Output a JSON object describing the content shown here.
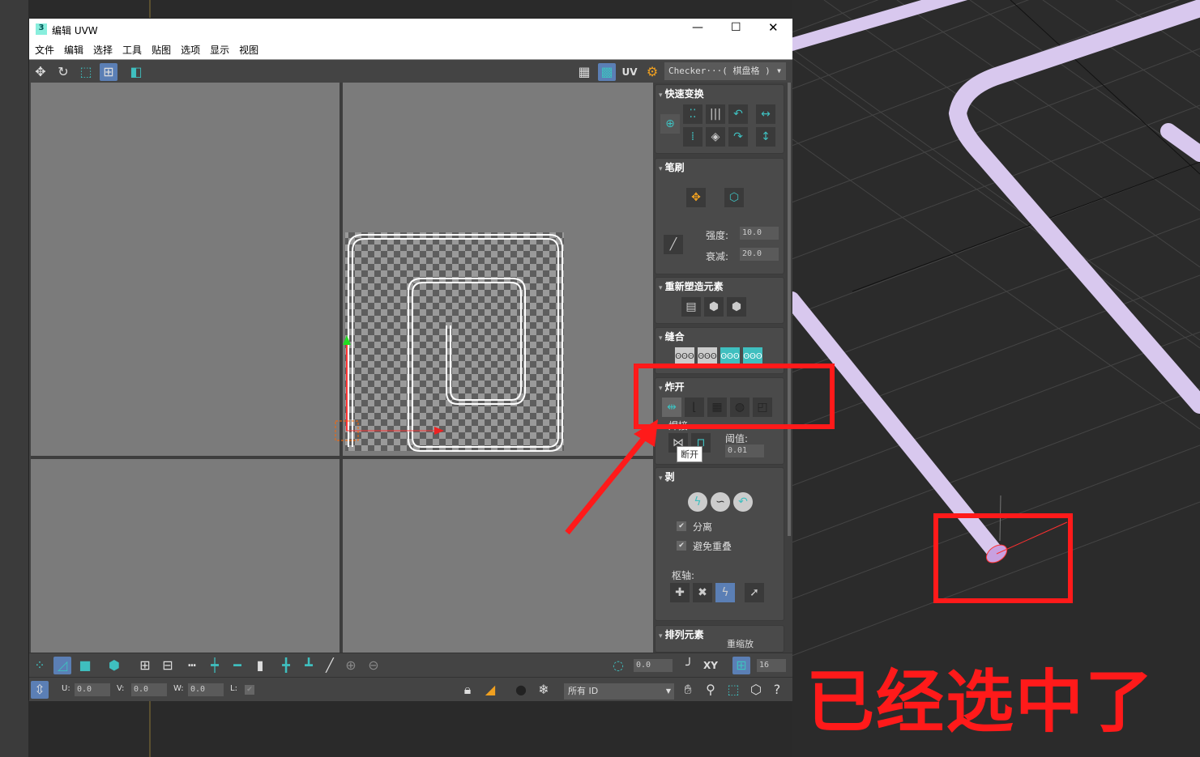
{
  "window": {
    "title": "编辑 UVW",
    "app_icon": "3"
  },
  "menu": [
    "文件",
    "编辑",
    "选择",
    "工具",
    "贴图",
    "选项",
    "显示",
    "视图"
  ],
  "toolbar": {
    "uv_label": "UV",
    "texture_dropdown": "Checker···( 棋盘格 )"
  },
  "rollouts": {
    "quick_transform": "快速变换",
    "brush": {
      "title": "笔刷",
      "strength_label": "强度:",
      "strength": "10.0",
      "falloff_label": "衰减:",
      "falloff": "20.0"
    },
    "reshape": "重新塑造元素",
    "stitch": "缝合",
    "explode": {
      "title": "炸开",
      "weld_label": "焊接",
      "threshold_label": "阈值:",
      "threshold": "0.01",
      "tooltip": "断开"
    },
    "peel": {
      "title": "剥",
      "detach_label": "分离",
      "avoid_overlap_label": "避免重叠",
      "detach_checked": true,
      "avoid_overlap_checked": true,
      "pivot_label": "枢轴:"
    },
    "arrange": {
      "title": "排列元素",
      "partial": "重缩放"
    }
  },
  "bottom": {
    "rotate_value": "0.0",
    "xy_label": "XY",
    "grid_value": "16",
    "u_label": "U:",
    "u": "0.0",
    "v_label": "V:",
    "v": "0.0",
    "w_label": "W:",
    "w": "0.0",
    "l_label": "L:",
    "id_dropdown": "所有 ID"
  },
  "annotation": {
    "text": "已经选中了",
    "color": "#ff1a1a"
  },
  "colors": {
    "accent": "#3fbfbf",
    "selected": "#5b7fb5",
    "tube": "#d8c8ee"
  }
}
